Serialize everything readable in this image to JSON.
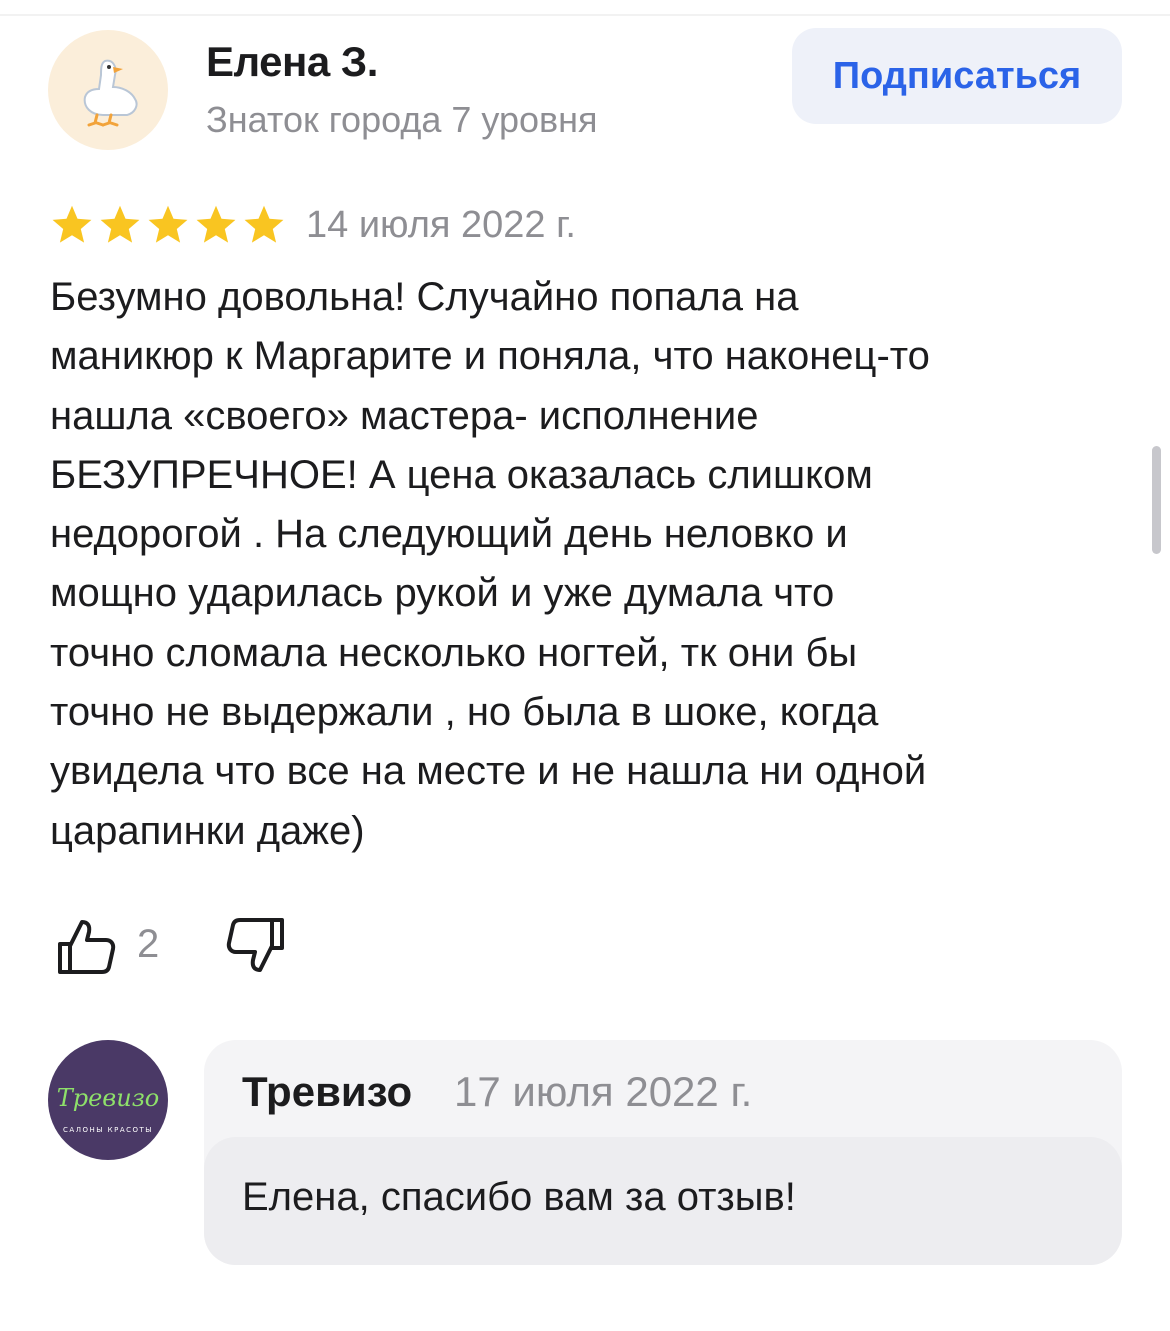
{
  "review": {
    "author_name": "Елена З.",
    "author_level": "Знаток города 7 уровня",
    "avatar_icon": "goose-icon",
    "subscribe_label": "Подписаться",
    "rating": 5,
    "rating_max": 5,
    "date": "14 июля 2022 г.",
    "text": "Безумно довольна! Случайно попала на\nманикюр к Маргарите и поняла, что наконец-то\nнашла «своего» мастера- исполнение\nБЕЗУПРЕЧНОЕ! А цена оказалась слишком\nнедорогой . На следующий день неловко и\nмощно  ударилась рукой и уже думала что\nточно сломала несколько ногтей, тк они бы\nточно не выдержали , но была в шоке, когда\nувидела что все на месте и не нашла ни одной\nцарапинки даже)",
    "likes": "2"
  },
  "reply": {
    "author_name": "Тревизо",
    "date": "17 июля 2022 г.",
    "text": "Елена, спасибо вам за отзыв!",
    "logo_text": "Тревизо",
    "logo_subtext": "САЛОНЫ КРАСОТЫ"
  },
  "colors": {
    "accent": "#2b63e8",
    "star": "#f9c521",
    "secondary_text": "#8e8e93",
    "logo_bg": "#4a3966",
    "logo_text": "#8ee06a"
  }
}
